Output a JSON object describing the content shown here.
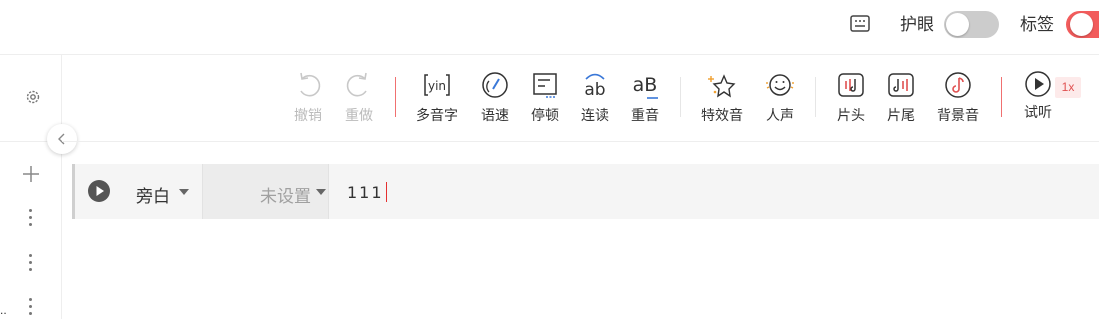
{
  "topbar": {
    "keyboard_icon": "keyboard-icon",
    "eye_care_label": "护眼",
    "eye_care_on": false,
    "tags_label": "标签",
    "tags_on": true
  },
  "sidebar": {
    "settings_icon": "gear-icon",
    "add_icon": "plus-icon",
    "more_icon": "vertical-dots-icon",
    "stray_text": "..",
    "collapse_icon": "chevron-left-icon"
  },
  "toolbar": {
    "undo": "撤销",
    "redo": "重做",
    "polyphone": "多音字",
    "polyphone_icon_text": "yin",
    "speed": "语速",
    "pause": "停顿",
    "liaison": "连读",
    "liaison_icon_text": "ab",
    "stress": "重音",
    "stress_icon_text": "aB",
    "effects": "特效音",
    "human_voice": "人声",
    "intro": "片头",
    "outro": "片尾",
    "bgm": "背景音",
    "preview": "试听",
    "preview_speed": "1x"
  },
  "row": {
    "role": "旁白",
    "voice": "未设置",
    "text": "111"
  },
  "colors": {
    "accent": "#f25c5c",
    "separator": "#f07070",
    "switch_off": "#cccccc",
    "disabled": "#bbbbbb"
  }
}
